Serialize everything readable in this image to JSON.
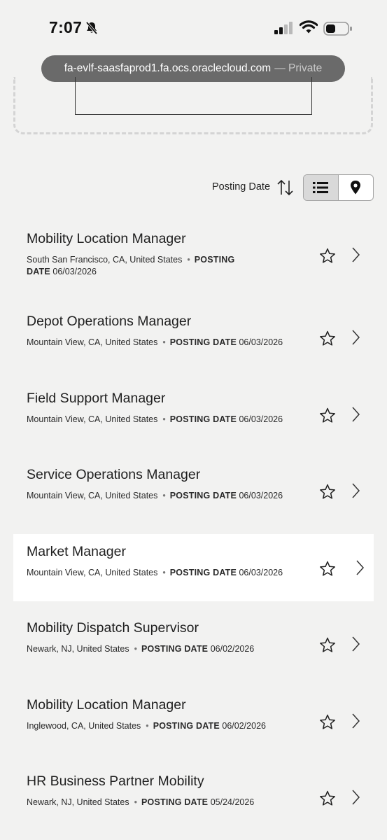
{
  "status": {
    "time": "7:07",
    "icons": [
      "bell-slash-icon",
      "signal-icon",
      "wifi-icon",
      "battery-icon"
    ]
  },
  "browser": {
    "url": "fa-evlf-saasfaprod1.fa.ocs.oraclecloud.com",
    "separator": "—",
    "mode": "Private"
  },
  "toolbar": {
    "sort_label": "Posting Date",
    "sort_icon": "sort-arrows-icon",
    "views": [
      "list-view-icon",
      "map-pin-icon"
    ],
    "active_view": "list"
  },
  "common": {
    "dot": "•",
    "posting_date_label": "POSTING DATE"
  },
  "jobs": [
    {
      "title": "Mobility Location Manager",
      "location": "South San Francisco, CA, United States",
      "posting_label_1": "POSTING",
      "posting_label_2": "DATE",
      "date": "06/03/2026"
    },
    {
      "title": "Depot Operations Manager",
      "location": "Mountain View, CA, United States",
      "date": "06/03/2026"
    },
    {
      "title": "Field Support Manager",
      "location": "Mountain View, CA, United States",
      "date": "06/03/2026"
    },
    {
      "title": "Service Operations Manager",
      "location": "Mountain View, CA, United States",
      "date": "06/03/2026"
    },
    {
      "title": "Market Manager",
      "location": "Mountain View, CA, United States",
      "date": "06/03/2026"
    },
    {
      "title": "Mobility Dispatch Supervisor",
      "location": "Newark, NJ, United States",
      "date": "06/02/2026"
    },
    {
      "title": "Mobility Location Manager",
      "location": "Inglewood, CA, United States",
      "date": "06/02/2026"
    },
    {
      "title": "HR Business Partner Mobility",
      "location": "Newark, NJ, United States",
      "date": "05/24/2026"
    }
  ]
}
